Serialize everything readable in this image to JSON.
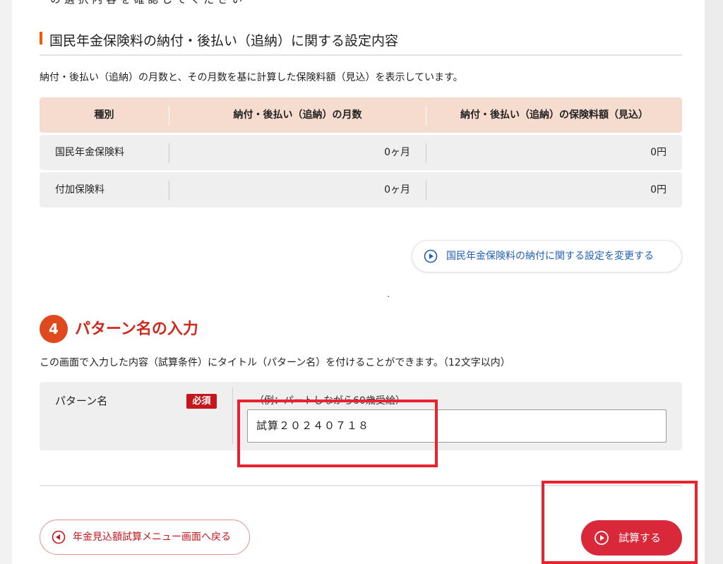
{
  "partial_top_text": "　の 選 択 内 容 を 確 認 し て く だ さ い",
  "section": {
    "title": "国民年金保険料の納付・後払い（追納）に関する設定内容",
    "description": "納付・後払い（追納）の月数と、その月数を基に計算した保険料額（見込）を表示しています。"
  },
  "table": {
    "headers": [
      "種別",
      "納付・後払い（追納）の月数",
      "納付・後払い（追納）の保険料額（見込）"
    ],
    "rows": [
      {
        "type": "国民年金保険料",
        "months": "0ヶ月",
        "amount": "0円"
      },
      {
        "type": "付加保険料",
        "months": "0ヶ月",
        "amount": "0円"
      }
    ]
  },
  "change_button": {
    "label": "国民年金保険料の納付に関する設定を変更する",
    "icon": "play-circle-icon"
  },
  "step4": {
    "number": "4",
    "title": "パターン名の入力",
    "description": "この画面で入力した内容（試算条件）にタイトル（パターン名）を付けることができます。（12文字以内）",
    "field_label": "パターン名",
    "required_badge": "必須",
    "example": "（例：パートしながら60歳受給）",
    "input_value": "試算２０２４０７１８"
  },
  "back_button": {
    "label": "年金見込額試算メニュー画面へ戻る",
    "icon": "back-circle-icon"
  },
  "calc_button": {
    "label": "試算する",
    "icon": "play-circle-icon"
  },
  "colors": {
    "accent": "#f05a00",
    "step_title": "#d02a1e",
    "table_header": "#f6dbcf",
    "primary_button": "#d8283a",
    "highlight": "#e8232f",
    "link_blue": "#1f5fb5"
  }
}
